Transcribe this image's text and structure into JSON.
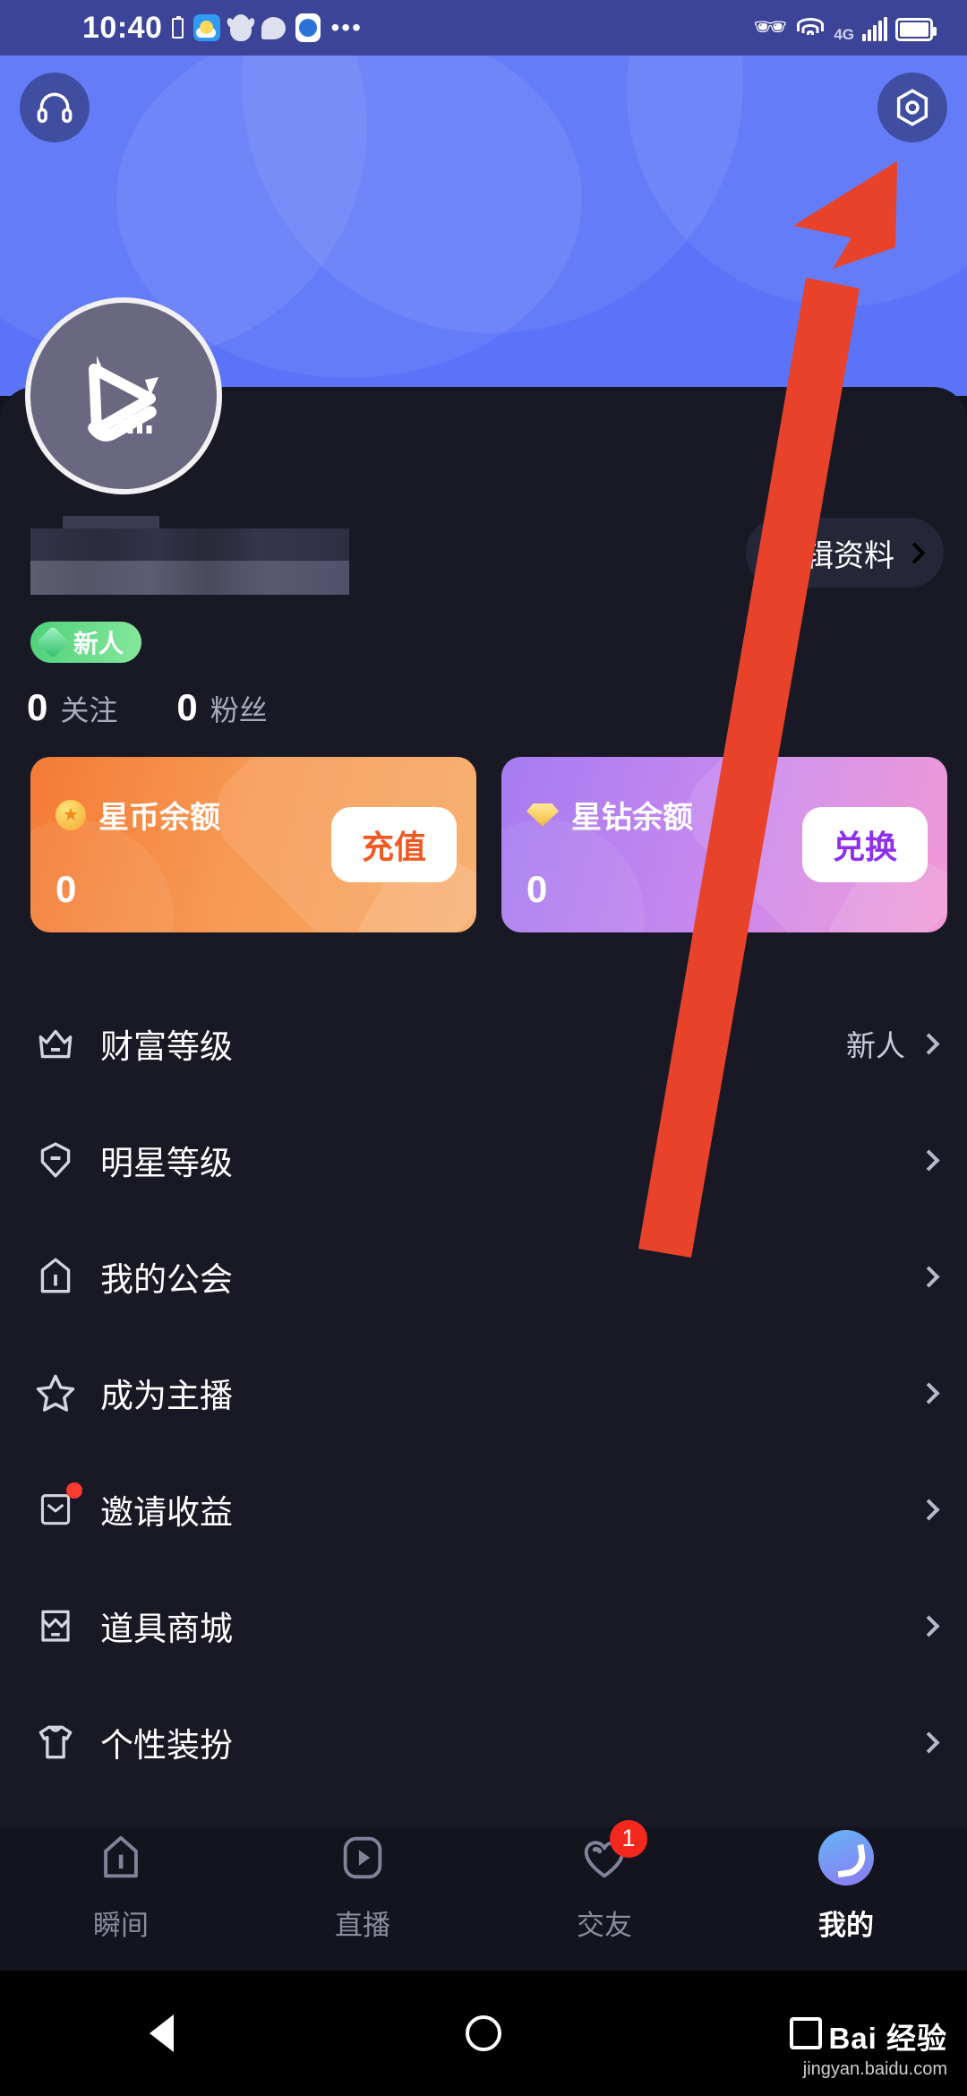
{
  "status_bar": {
    "time": "10:40",
    "network": "4G",
    "icons": [
      "battery-small-icon",
      "weather-icon",
      "qq-icon",
      "message-icon",
      "browser-icon",
      "more-dots-icon",
      "bluetooth-icon",
      "wifi-icon",
      "signal-icon",
      "battery-icon"
    ]
  },
  "header": {
    "headset_icon": "headset-icon",
    "settings_icon": "settings-gear-icon"
  },
  "profile": {
    "avatar_icon": "app-logo-avatar",
    "username": "",
    "edit_button_label": "编辑资料",
    "badge_label": "新人",
    "stats": [
      {
        "value": "0",
        "label": "关注"
      },
      {
        "value": "0",
        "label": "粉丝"
      }
    ]
  },
  "wallets": [
    {
      "icon": "star-coin-icon",
      "title": "星币余额",
      "amount": "0",
      "action_label": "充值",
      "accent": "#f05a22"
    },
    {
      "icon": "star-diamond-icon",
      "title": "星钻余额",
      "amount": "0",
      "action_label": "兑换",
      "accent": "#8e2ff0"
    }
  ],
  "menu": [
    {
      "icon": "crown-icon",
      "label": "财富等级",
      "value": "新人",
      "dot": false
    },
    {
      "icon": "shield-icon",
      "label": "明星等级",
      "value": "",
      "dot": false
    },
    {
      "icon": "guild-icon",
      "label": "我的公会",
      "value": "",
      "dot": false
    },
    {
      "icon": "star-icon",
      "label": "成为主播",
      "value": "",
      "dot": false
    },
    {
      "icon": "invite-icon",
      "label": "邀请收益",
      "value": "",
      "dot": true
    },
    {
      "icon": "shop-icon",
      "label": "道具商城",
      "value": "",
      "dot": false
    },
    {
      "icon": "tshirt-icon",
      "label": "个性装扮",
      "value": "",
      "dot": false
    }
  ],
  "tabs": [
    {
      "icon": "moment-icon",
      "label": "瞬间",
      "badge": "",
      "active": false
    },
    {
      "icon": "live-icon",
      "label": "直播",
      "badge": "",
      "active": false
    },
    {
      "icon": "heart-icon",
      "label": "交友",
      "badge": "1",
      "active": false
    },
    {
      "icon": "profile-icon",
      "label": "我的",
      "badge": "",
      "active": true
    }
  ],
  "system_nav": [
    "back-icon",
    "home-icon",
    "recents-icon"
  ],
  "watermark": {
    "line1": "Bai 经验",
    "line2": "jingyan.baidu.com"
  },
  "colors": {
    "banner": "#5a73f8",
    "sheet": "#191926",
    "status_bar": "#3c4499",
    "badge_green": "#4fd17a",
    "annotation_red": "#e8432a"
  }
}
